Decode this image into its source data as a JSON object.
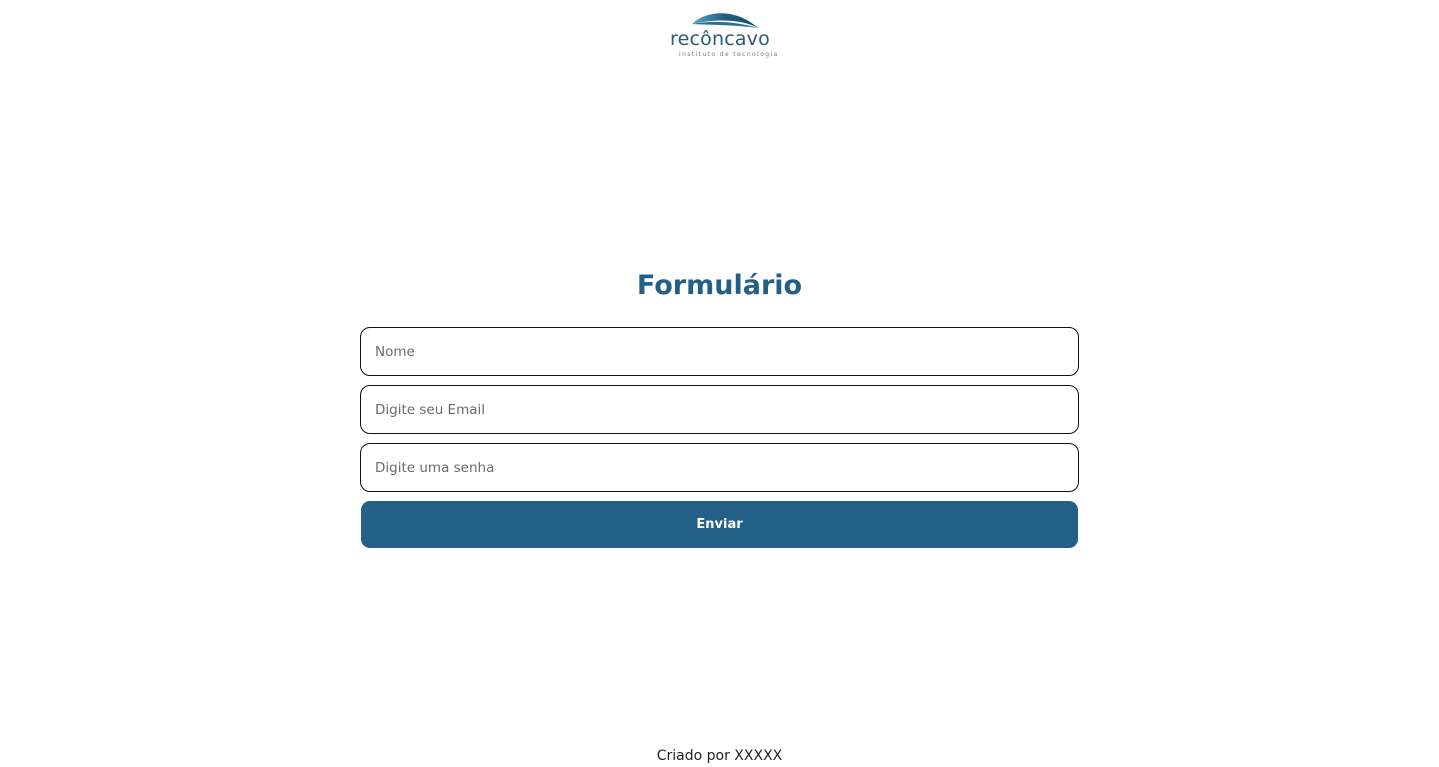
{
  "brand": {
    "name": "recôncavo",
    "tagline": "instituto de tecnologia",
    "colors": {
      "primary": "#236088",
      "logo_wave": "#1f5f82",
      "logo_text": "#2b5a73"
    }
  },
  "form": {
    "title": "Formulário",
    "fields": {
      "name_placeholder": "Nome",
      "email_placeholder": "Digite seu Email",
      "password_placeholder": "Digite uma senha"
    },
    "submit_label": "Enviar"
  },
  "footer": {
    "text": "Criado por XXXXX"
  }
}
